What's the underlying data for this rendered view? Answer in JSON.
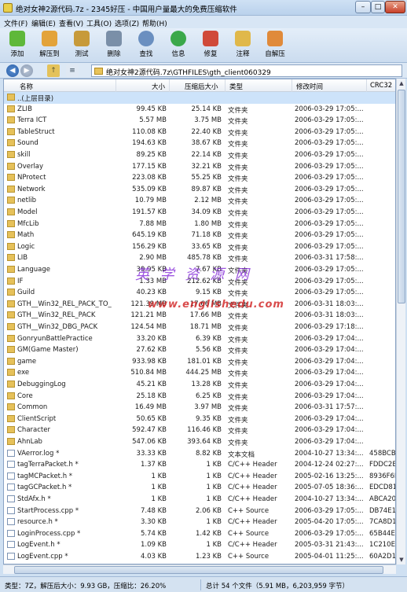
{
  "window": {
    "title": "绝对女神2源代码.7z - 2345好压 - 中国用户量最大的免费压缩软件",
    "btn_min": "–",
    "btn_max": "□",
    "btn_close": "✕"
  },
  "menu": [
    "文件(F)",
    "编辑(E)",
    "查看(V)",
    "工具(O)",
    "选项(Z)",
    "帮助(H)"
  ],
  "toolbar": [
    {
      "label": "添加",
      "icon": "add-icon",
      "color": "#5fb83a"
    },
    {
      "label": "解压到",
      "icon": "extract-icon",
      "color": "#e3a33a"
    },
    {
      "label": "测试",
      "icon": "test-icon",
      "color": "#c79a3a"
    },
    {
      "label": "删除",
      "icon": "delete-icon",
      "color": "#7a8fa8"
    },
    {
      "label": "查找",
      "icon": "find-icon",
      "color": "#6a8fc0"
    },
    {
      "label": "信息",
      "icon": "info-icon",
      "color": "#3aa84a"
    },
    {
      "label": "修复",
      "icon": "repair-icon",
      "color": "#d04a3a"
    },
    {
      "label": "注释",
      "icon": "comment-icon",
      "color": "#e0b84a"
    },
    {
      "label": "自解压",
      "icon": "sfx-icon",
      "color": "#e08a3a"
    }
  ],
  "address": {
    "path": "绝对女神2源代码.7z\\GTHFILES\\gth_client060329",
    "back": "◀",
    "forward": "▶",
    "up": "↑",
    "view": "≡"
  },
  "columns": {
    "name": "名称",
    "size": "大小",
    "packed": "压缩后大小",
    "type": "类型",
    "mtime": "修改时间",
    "crc": "CRC32"
  },
  "rows": [
    {
      "kind": "up",
      "name": "..(上层目录)",
      "size": "",
      "packed": "",
      "type": "",
      "mtime": "",
      "crc": ""
    },
    {
      "kind": "folder",
      "name": "ZLIB",
      "size": "99.45 KB",
      "packed": "25.14 KB",
      "type": "文件夹",
      "mtime": "2006-03-29 17:05:...",
      "crc": ""
    },
    {
      "kind": "folder",
      "name": "Terra ICT",
      "size": "5.57 MB",
      "packed": "3.75 MB",
      "type": "文件夹",
      "mtime": "2006-03-29 17:05:...",
      "crc": ""
    },
    {
      "kind": "folder",
      "name": "TableStruct",
      "size": "110.08 KB",
      "packed": "22.40 KB",
      "type": "文件夹",
      "mtime": "2006-03-29 17:05:...",
      "crc": ""
    },
    {
      "kind": "folder",
      "name": "Sound",
      "size": "194.63 KB",
      "packed": "38.67 KB",
      "type": "文件夹",
      "mtime": "2006-03-29 17:05:...",
      "crc": ""
    },
    {
      "kind": "folder",
      "name": "skill",
      "size": "89.25 KB",
      "packed": "22.14 KB",
      "type": "文件夹",
      "mtime": "2006-03-29 17:05:...",
      "crc": ""
    },
    {
      "kind": "folder",
      "name": "Overlay",
      "size": "177.15 KB",
      "packed": "32.21 KB",
      "type": "文件夹",
      "mtime": "2006-03-29 17:05:...",
      "crc": ""
    },
    {
      "kind": "folder",
      "name": "NProtect",
      "size": "223.08 KB",
      "packed": "55.25 KB",
      "type": "文件夹",
      "mtime": "2006-03-29 17:05:...",
      "crc": ""
    },
    {
      "kind": "folder",
      "name": "Network",
      "size": "535.09 KB",
      "packed": "89.87 KB",
      "type": "文件夹",
      "mtime": "2006-03-29 17:05:...",
      "crc": ""
    },
    {
      "kind": "folder",
      "name": "netlib",
      "size": "10.79 MB",
      "packed": "2.12 MB",
      "type": "文件夹",
      "mtime": "2006-03-29 17:05:...",
      "crc": ""
    },
    {
      "kind": "folder",
      "name": "Model",
      "size": "191.57 KB",
      "packed": "34.09 KB",
      "type": "文件夹",
      "mtime": "2006-03-29 17:05:...",
      "crc": ""
    },
    {
      "kind": "folder",
      "name": "MfcLib",
      "size": "7.88 MB",
      "packed": "1.80 MB",
      "type": "文件夹",
      "mtime": "2006-03-29 17:05:...",
      "crc": ""
    },
    {
      "kind": "folder",
      "name": "Math",
      "size": "645.19 KB",
      "packed": "71.18 KB",
      "type": "文件夹",
      "mtime": "2006-03-29 17:05:...",
      "crc": ""
    },
    {
      "kind": "folder",
      "name": "Logic",
      "size": "156.29 KB",
      "packed": "33.65 KB",
      "type": "文件夹",
      "mtime": "2006-03-29 17:05:...",
      "crc": ""
    },
    {
      "kind": "folder",
      "name": "LIB",
      "size": "2.90 MB",
      "packed": "485.78 KB",
      "type": "文件夹",
      "mtime": "2006-03-31 17:58:...",
      "crc": ""
    },
    {
      "kind": "folder",
      "name": "Language",
      "size": "39.95 KB",
      "packed": "7.67 KB",
      "type": "文件夹",
      "mtime": "2006-03-29 17:05:...",
      "crc": ""
    },
    {
      "kind": "folder",
      "name": "IF",
      "size": "1.33 MB",
      "packed": "212.62 KB",
      "type": "文件夹",
      "mtime": "2006-03-29 17:05:...",
      "crc": ""
    },
    {
      "kind": "folder",
      "name": "Guild",
      "size": "40.23 KB",
      "packed": "9.15 KB",
      "type": "文件夹",
      "mtime": "2006-03-29 17:05:...",
      "crc": ""
    },
    {
      "kind": "folder",
      "name": "GTH__Win32_REL_PACK_TO_...",
      "size": "121.39 MB",
      "packed": "17.66 MB",
      "type": "文件夹",
      "mtime": "2006-03-31 18:03:...",
      "crc": ""
    },
    {
      "kind": "folder",
      "name": "GTH__Win32_REL_PACK",
      "size": "121.21 MB",
      "packed": "17.66 MB",
      "type": "文件夹",
      "mtime": "2006-03-31 18:03:...",
      "crc": ""
    },
    {
      "kind": "folder",
      "name": "GTH__Win32_DBG_PACK",
      "size": "124.54 MB",
      "packed": "18.71 MB",
      "type": "文件夹",
      "mtime": "2006-03-29 17:18:...",
      "crc": ""
    },
    {
      "kind": "folder",
      "name": "GonryunBattlePractice",
      "size": "33.20 KB",
      "packed": "6.39 KB",
      "type": "文件夹",
      "mtime": "2006-03-29 17:04:...",
      "crc": ""
    },
    {
      "kind": "folder",
      "name": "GM(Game Master)",
      "size": "27.62 KB",
      "packed": "5.56 KB",
      "type": "文件夹",
      "mtime": "2006-03-29 17:04:...",
      "crc": ""
    },
    {
      "kind": "folder",
      "name": "game",
      "size": "933.98 KB",
      "packed": "181.01 KB",
      "type": "文件夹",
      "mtime": "2006-03-29 17:04:...",
      "crc": ""
    },
    {
      "kind": "folder",
      "name": "exe",
      "size": "510.84 MB",
      "packed": "444.25 MB",
      "type": "文件夹",
      "mtime": "2006-03-29 17:04:...",
      "crc": ""
    },
    {
      "kind": "folder",
      "name": "DebuggingLog",
      "size": "45.21 KB",
      "packed": "13.28 KB",
      "type": "文件夹",
      "mtime": "2006-03-29 17:04:...",
      "crc": ""
    },
    {
      "kind": "folder",
      "name": "Core",
      "size": "25.18 KB",
      "packed": "6.25 KB",
      "type": "文件夹",
      "mtime": "2006-03-29 17:04:...",
      "crc": ""
    },
    {
      "kind": "folder",
      "name": "Common",
      "size": "16.49 MB",
      "packed": "3.97 MB",
      "type": "文件夹",
      "mtime": "2006-03-31 17:57:...",
      "crc": ""
    },
    {
      "kind": "folder",
      "name": "ClientScript",
      "size": "50.65 KB",
      "packed": "9.35 KB",
      "type": "文件夹",
      "mtime": "2006-03-29 17:04:...",
      "crc": ""
    },
    {
      "kind": "folder",
      "name": "Character",
      "size": "592.47 KB",
      "packed": "116.46 KB",
      "type": "文件夹",
      "mtime": "2006-03-29 17:04:...",
      "crc": ""
    },
    {
      "kind": "folder",
      "name": "AhnLab",
      "size": "547.06 KB",
      "packed": "393.64 KB",
      "type": "文件夹",
      "mtime": "2006-03-29 17:04:...",
      "crc": ""
    },
    {
      "kind": "file",
      "name": "VAerror.log *",
      "size": "33.33 KB",
      "packed": "8.82 KB",
      "type": "文本文档",
      "mtime": "2004-10-27 13:34:...",
      "crc": "458BCB5..."
    },
    {
      "kind": "file",
      "name": "tagTerraPacket.h *",
      "size": "1.37 KB",
      "packed": "1 KB",
      "type": "C/C++ Header",
      "mtime": "2004-12-24 02:27:...",
      "crc": "FDDC2E3..."
    },
    {
      "kind": "file",
      "name": "tagMCPacket.h *",
      "size": "1 KB",
      "packed": "1 KB",
      "type": "C/C++ Header",
      "mtime": "2005-02-16 13:25:...",
      "crc": "8936F6F3..."
    },
    {
      "kind": "file",
      "name": "tagGCPacket.h *",
      "size": "1 KB",
      "packed": "1 KB",
      "type": "C/C++ Header",
      "mtime": "2005-07-05 18:36:...",
      "crc": "EDCD81E..."
    },
    {
      "kind": "file",
      "name": "StdAfx.h *",
      "size": "1 KB",
      "packed": "1 KB",
      "type": "C/C++ Header",
      "mtime": "2004-10-27 13:34:...",
      "crc": "ABCA202..."
    },
    {
      "kind": "file",
      "name": "StartProcess.cpp *",
      "size": "7.48 KB",
      "packed": "2.06 KB",
      "type": "C++ Source",
      "mtime": "2006-03-29 17:05:...",
      "crc": "DB74E11..."
    },
    {
      "kind": "file",
      "name": "resource.h *",
      "size": "3.30 KB",
      "packed": "1 KB",
      "type": "C/C++ Header",
      "mtime": "2005-04-20 17:05:...",
      "crc": "7CA8D1E..."
    },
    {
      "kind": "file",
      "name": "LoginProcess.cpp *",
      "size": "5.74 KB",
      "packed": "1.42 KB",
      "type": "C++ Source",
      "mtime": "2006-03-29 17:05:...",
      "crc": "65B44ED..."
    },
    {
      "kind": "file",
      "name": "LogEvent.h *",
      "size": "1.09 KB",
      "packed": "1 KB",
      "type": "C/C++ Header",
      "mtime": "2005-03-31 21:43:...",
      "crc": "1C210EE7..."
    },
    {
      "kind": "file",
      "name": "LogEvent.cpp *",
      "size": "4.03 KB",
      "packed": "1.23 KB",
      "type": "C++ Source",
      "mtime": "2005-04-01 11:25:...",
      "crc": "60A2D10..."
    }
  ],
  "watermark": {
    "text1": "英 学 资 源 网",
    "text2": "www.englishedu.com"
  },
  "status": {
    "left": "类型：7Z，解压后大小：9.93 GB，压缩比：26.20%",
    "right": "总计 54 个文件（5.91 MB，6,203,959 字节）"
  }
}
